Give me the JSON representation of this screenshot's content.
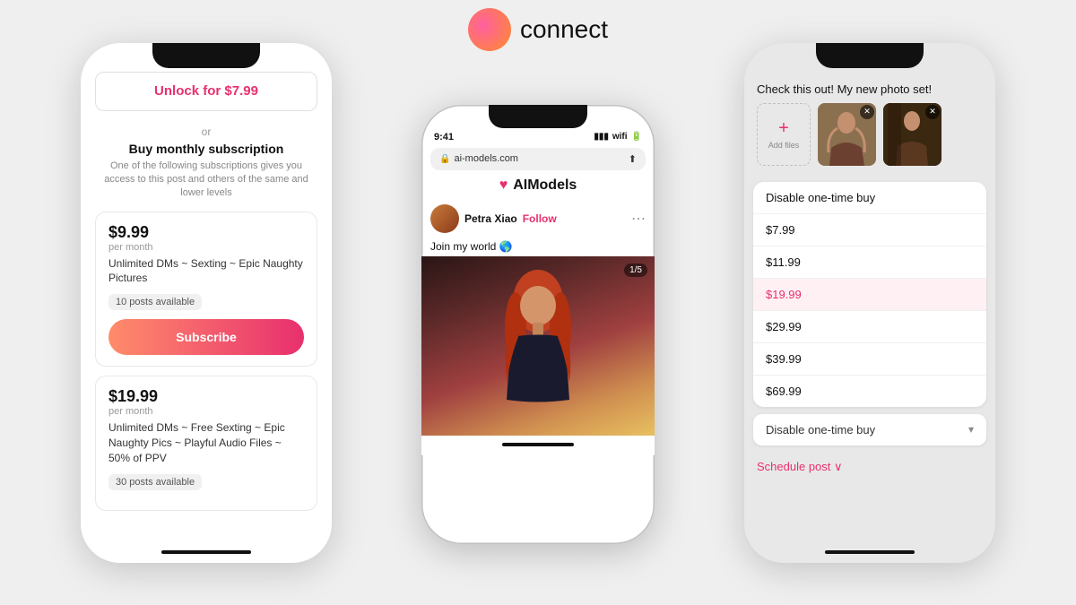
{
  "scene": {
    "background": "#efefef"
  },
  "brand": {
    "name": "connect"
  },
  "left_phone": {
    "unlock_label": "Unlock for $7.99",
    "or_label": "or",
    "buy_monthly_title": "Buy monthly subscription",
    "buy_monthly_desc": "One of the following subscriptions gives you access to this post and others of the same and lower levels",
    "subscription1": {
      "price": "$9.99",
      "period": "per month",
      "description": "Unlimited DMs ~ Sexting ~ Epic Naughty Pictures",
      "posts_available": "10 posts available",
      "subscribe_label": "Subscribe"
    },
    "subscription2": {
      "price": "$19.99",
      "period": "per month",
      "description": "Unlimited DMs ~ Free Sexting ~ Epic Naughty Pics ~ Playful Audio Files ~ 50% of PPV",
      "posts_available": "30 posts available"
    }
  },
  "center_phone": {
    "brand_name": "AIModels",
    "time": "9:41",
    "url": "ai-models.com",
    "user_name": "Petra Xiao",
    "follow_label": "Follow",
    "post_caption": "Join my world 🌎",
    "image_counter": "1/5"
  },
  "right_phone": {
    "post_text": "Check this out! My new photo set!",
    "add_files_label": "Add files",
    "dropdown_items": [
      {
        "label": "Disable one-time buy",
        "selected": false
      },
      {
        "label": "$7.99",
        "selected": false
      },
      {
        "label": "$11.99",
        "selected": false
      },
      {
        "label": "$19.99",
        "selected": true
      },
      {
        "label": "$29.99",
        "selected": false
      },
      {
        "label": "$39.99",
        "selected": false
      },
      {
        "label": "$69.99",
        "selected": false
      }
    ],
    "dropdown_select_label": "Disable one-time buy",
    "schedule_label": "Schedule post ∨"
  }
}
